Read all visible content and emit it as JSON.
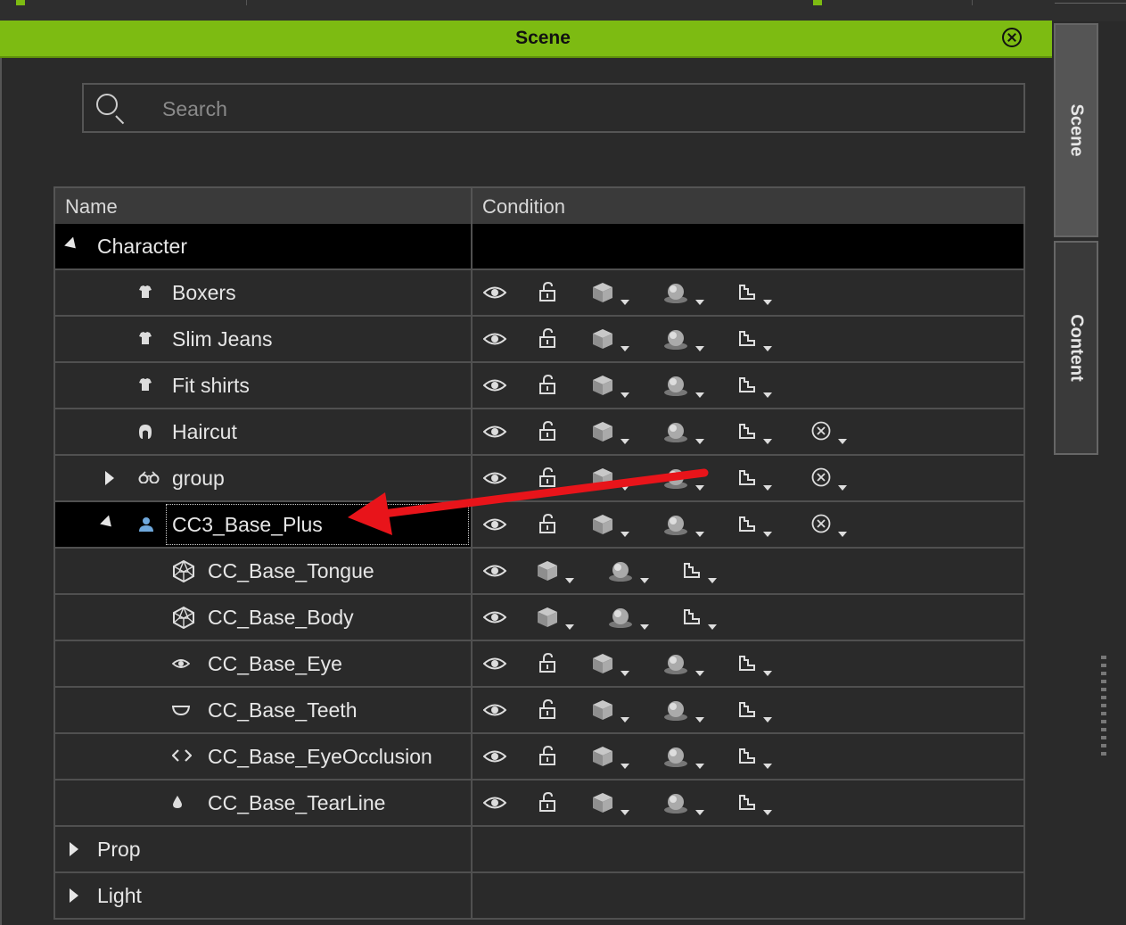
{
  "window": {
    "title": "Scene",
    "close_icon": "close-circle-icon"
  },
  "search": {
    "placeholder": "Search",
    "value": "",
    "icon": "search-icon"
  },
  "table": {
    "columns": [
      "Name",
      "Condition"
    ],
    "rows": [
      {
        "label": "Character",
        "type": "category",
        "expanded": true
      },
      {
        "label": "Boxers",
        "type": "cloth"
      },
      {
        "label": "Slim Jeans",
        "type": "cloth"
      },
      {
        "label": "Fit shirts",
        "type": "cloth"
      },
      {
        "label": "Haircut",
        "type": "hair"
      },
      {
        "label": "group",
        "type": "group",
        "expanded": false
      },
      {
        "label": "CC3_Base_Plus",
        "type": "avatar",
        "expanded": true,
        "selected": true
      },
      {
        "label": "CC_Base_Tongue",
        "type": "mesh"
      },
      {
        "label": "CC_Base_Body",
        "type": "mesh"
      },
      {
        "label": "CC_Base_Eye",
        "type": "eye"
      },
      {
        "label": "CC_Base_Teeth",
        "type": "teeth"
      },
      {
        "label": "CC_Base_EyeOcclusion",
        "type": "occlusion"
      },
      {
        "label": "CC_Base_TearLine",
        "type": "tearline"
      },
      {
        "label": "Prop",
        "type": "category",
        "expanded": false
      },
      {
        "label": "Light",
        "type": "category",
        "expanded": false
      }
    ]
  },
  "sidebar": {
    "tabs": [
      "Scene",
      "Content"
    ]
  },
  "colors": {
    "accent": "#7dbb12",
    "annotation_arrow": "#e8141a"
  }
}
